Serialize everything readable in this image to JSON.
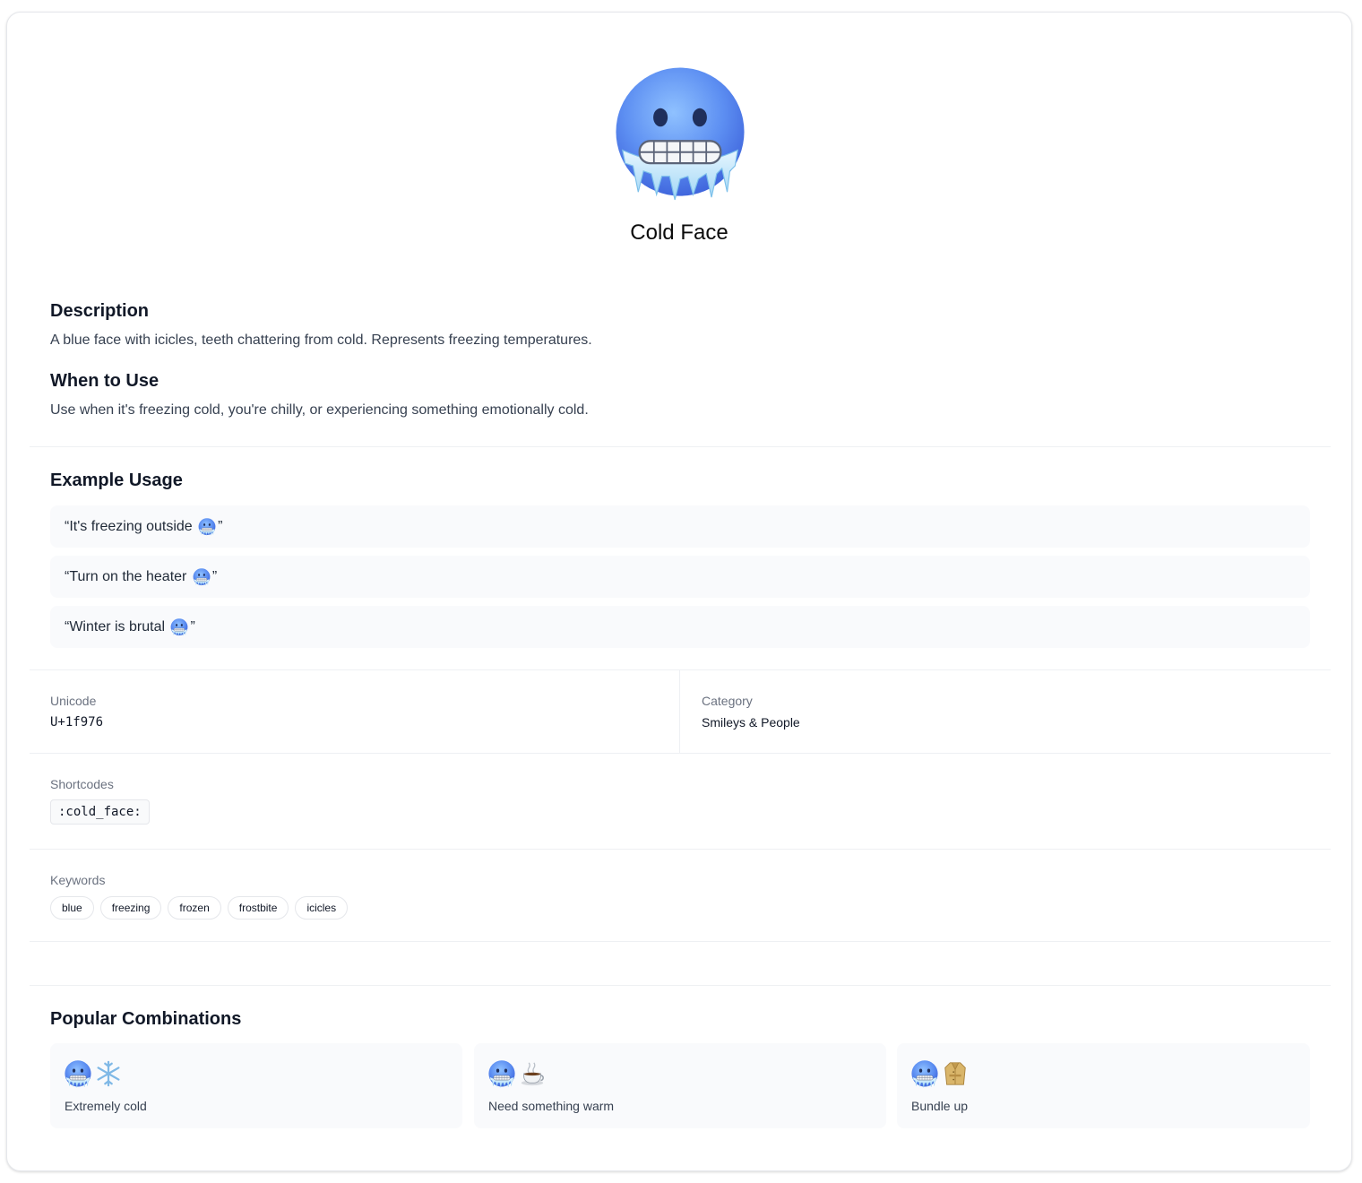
{
  "emoji": {
    "name": "Cold Face",
    "icon": "cold-face-icon",
    "colors": {
      "face": "#4f7ff0",
      "face_light": "#8fc1ff",
      "ice": "#bfe6ff"
    }
  },
  "description": {
    "heading": "Description",
    "text": "A blue face with icicles, teeth chattering from cold. Represents freezing temperatures."
  },
  "when_to_use": {
    "heading": "When to Use",
    "text": "Use when it's freezing cold, you're chilly, or experiencing something emotionally cold."
  },
  "examples": {
    "heading": "Example Usage",
    "items": [
      {
        "open": "“It's freezing outside ",
        "close": "”"
      },
      {
        "open": "“Turn on the heater ",
        "close": "”"
      },
      {
        "open": "“Winter is brutal ",
        "close": "”"
      }
    ]
  },
  "details": {
    "unicode_label": "Unicode",
    "unicode_value": "U+1f976",
    "category_label": "Category",
    "category_value": "Smileys & People"
  },
  "shortcodes": {
    "label": "Shortcodes",
    "items": [
      ":cold_face:"
    ]
  },
  "keywords": {
    "label": "Keywords",
    "items": [
      "blue",
      "freezing",
      "frozen",
      "frostbite",
      "icicles"
    ]
  },
  "combinations": {
    "heading": "Popular Combinations",
    "items": [
      {
        "icons": [
          "cold-face-icon",
          "snowflake-icon"
        ],
        "label": "Extremely cold"
      },
      {
        "icons": [
          "cold-face-icon",
          "hot-beverage-icon"
        ],
        "label": "Need something warm"
      },
      {
        "icons": [
          "cold-face-icon",
          "coat-icon"
        ],
        "label": "Bundle up"
      }
    ]
  }
}
